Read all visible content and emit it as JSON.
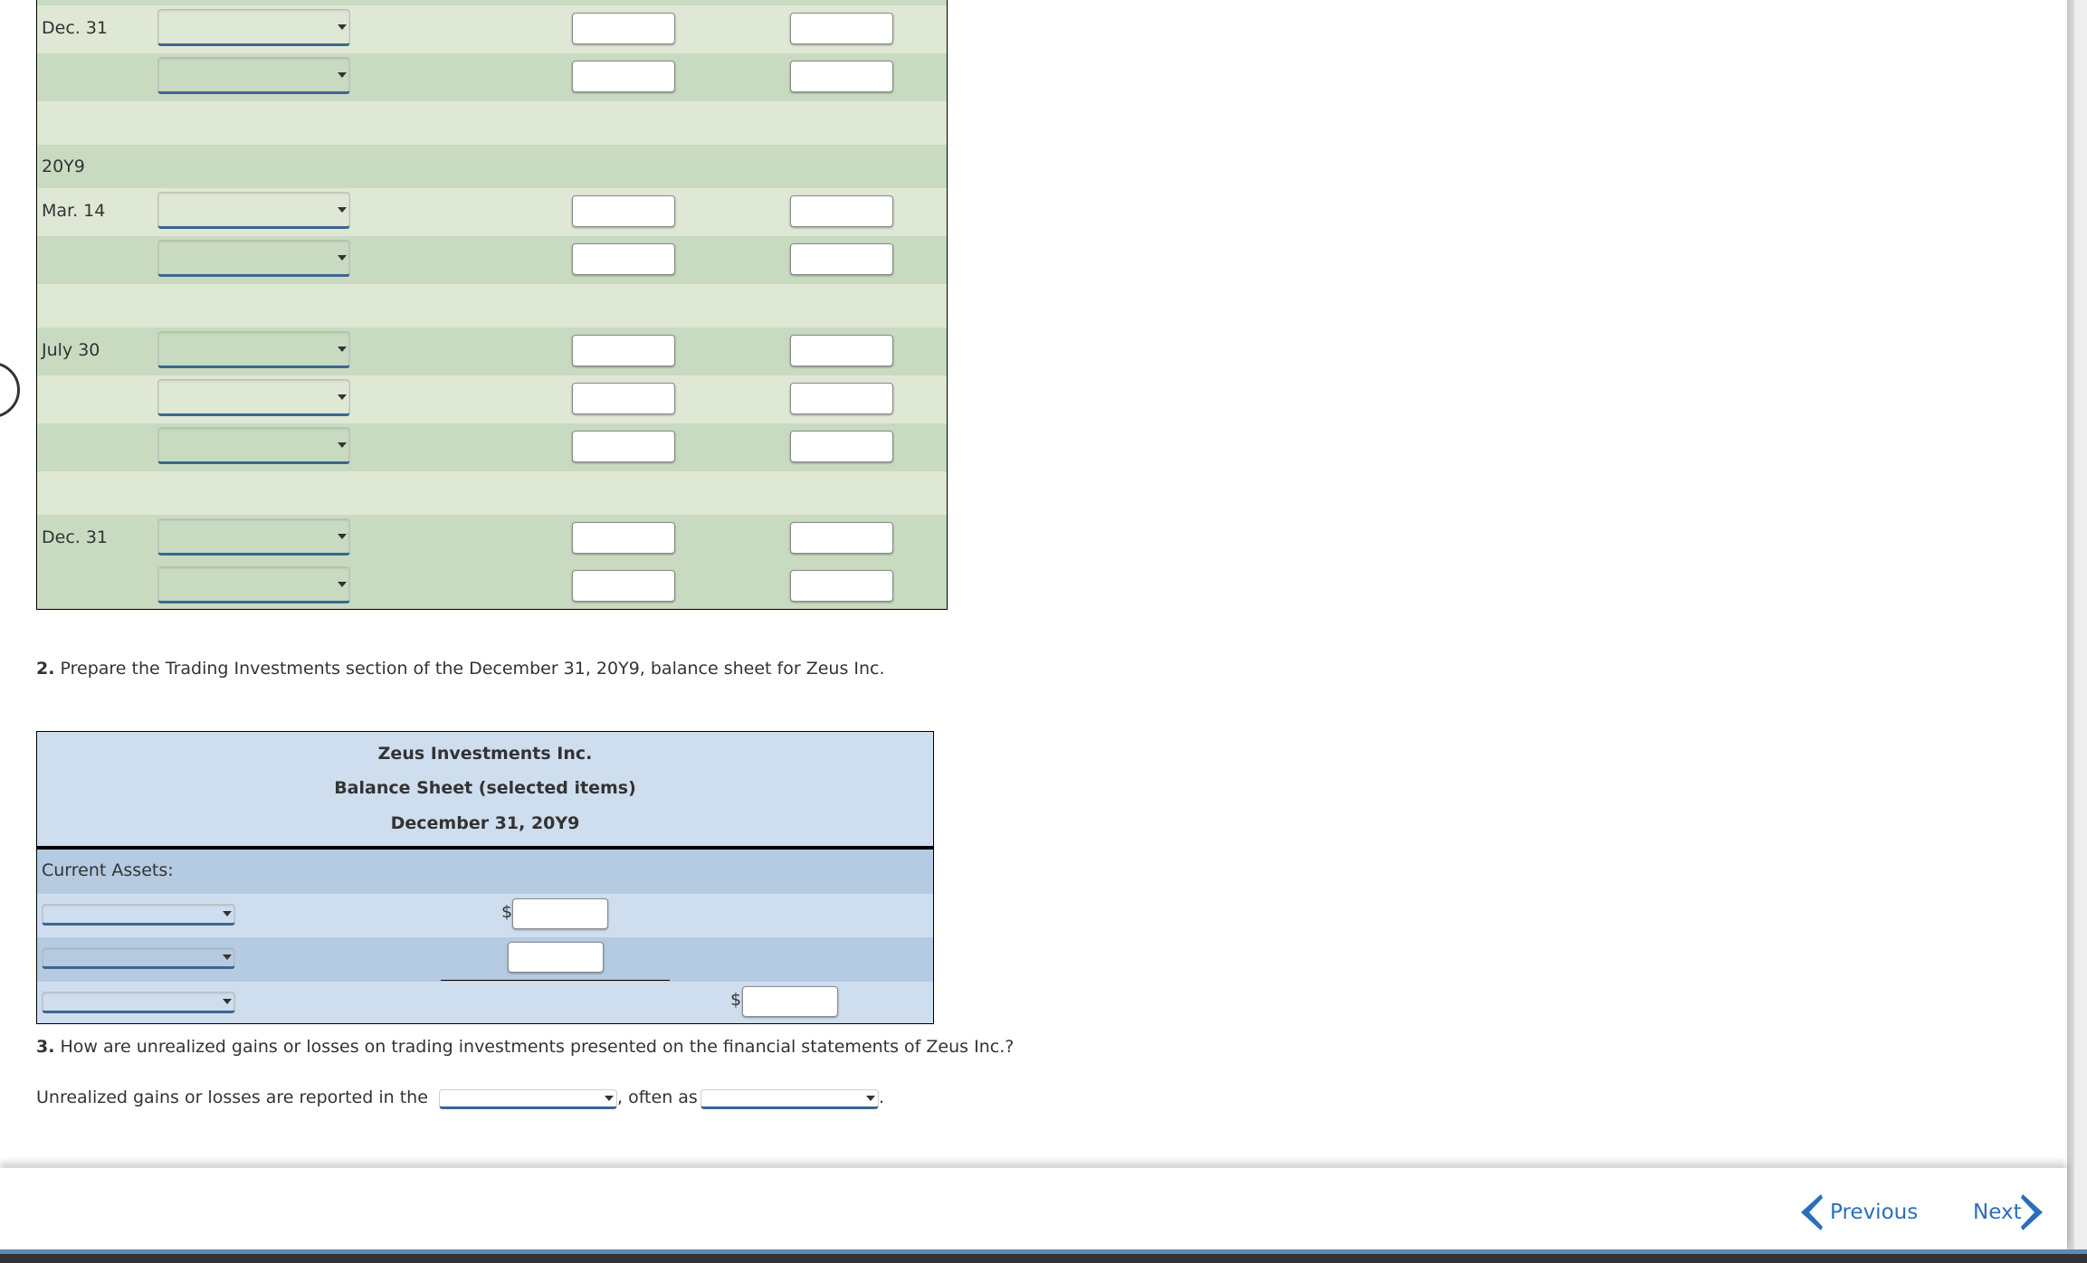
{
  "journal": {
    "rows": [
      {
        "type": "entry",
        "date": "Dec. 31",
        "shade": "light",
        "selected_account": "",
        "debit": "",
        "credit": ""
      },
      {
        "type": "entry",
        "date": "",
        "shade": "dark",
        "selected_account": "",
        "debit": "",
        "credit": ""
      },
      {
        "type": "blank",
        "shade": "light"
      },
      {
        "type": "year",
        "date": "20Y9",
        "shade": "dark"
      },
      {
        "type": "entry",
        "date": "Mar. 14",
        "shade": "light",
        "selected_account": "",
        "debit": "",
        "credit": ""
      },
      {
        "type": "entry",
        "date": "",
        "shade": "dark",
        "selected_account": "",
        "debit": "",
        "credit": ""
      },
      {
        "type": "blank",
        "shade": "light"
      },
      {
        "type": "entry",
        "date": "July 30",
        "shade": "dark",
        "selected_account": "",
        "debit": "",
        "credit": ""
      },
      {
        "type": "entry",
        "date": "",
        "shade": "light",
        "selected_account": "",
        "debit": "",
        "credit": ""
      },
      {
        "type": "entry",
        "date": "",
        "shade": "dark",
        "selected_account": "",
        "debit": "",
        "credit": ""
      },
      {
        "type": "blank",
        "shade": "light"
      },
      {
        "type": "entry",
        "date": "Dec. 31",
        "shade": "dark",
        "selected_account": "",
        "debit": "",
        "credit": ""
      },
      {
        "type": "entry",
        "date": "",
        "shade": "dark",
        "selected_account": "",
        "debit": "",
        "credit": ""
      }
    ]
  },
  "question2": {
    "number": "2.",
    "text": "Prepare the Trading Investments section of the December 31, 20Y9, balance sheet for Zeus Inc."
  },
  "balance_sheet": {
    "company": "Zeus Investments Inc.",
    "statement": "Balance Sheet (selected items)",
    "date": "December 31, 20Y9",
    "section_label": "Current Assets:",
    "currency_symbol": "$",
    "lines": [
      {
        "selected_account": "",
        "amount": "",
        "total": ""
      },
      {
        "selected_account": "",
        "amount": "",
        "total": ""
      },
      {
        "selected_account": "",
        "amount": "",
        "total": ""
      }
    ]
  },
  "question3": {
    "number": "3.",
    "text": "How are unrealized gains or losses on trading investments presented on the financial statements of Zeus Inc.?",
    "answer_prefix": "Unrealized gains or losses are reported in the",
    "answer_middle": ", often as",
    "answer_suffix": ".",
    "select1_value": "",
    "select2_value": ""
  },
  "footer": {
    "previous_label": "Previous",
    "next_label": "Next",
    "accent_color": "#2a6ebb"
  },
  "colors": {
    "journal_light": "#dfe8d5",
    "journal_dark": "#c8dbc1",
    "bs_light": "#cfdeee",
    "bs_dark": "#b4cbe2",
    "select_underline": "#3c6591"
  }
}
